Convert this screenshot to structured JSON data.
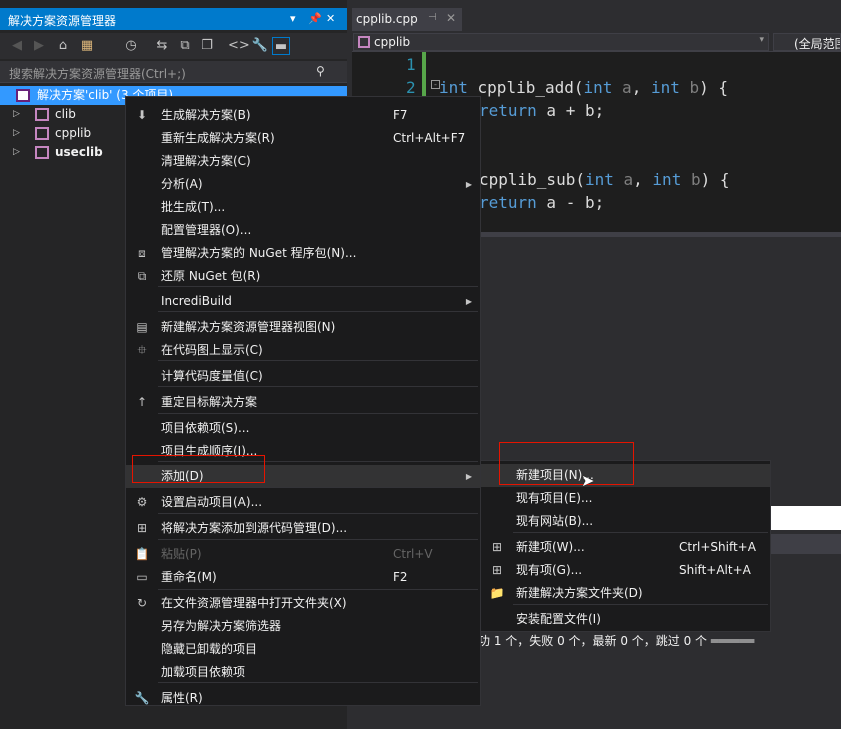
{
  "solution_explorer": {
    "title": "解决方案资源管理器",
    "search_placeholder": "搜索解决方案资源管理器(Ctrl+;)",
    "root_label": "解决方案'clib' (3 个项目)",
    "projects": [
      "clib",
      "cpplib",
      "useclib"
    ]
  },
  "editor": {
    "tab_label": "cpplib.cpp",
    "nav_project": "cpplib",
    "nav_scope": "(全局范围",
    "lines": [
      {
        "num": "1",
        "text": ""
      },
      {
        "num": "2",
        "text": "int cpplib_add(int a, int b) {"
      },
      {
        "num": "",
        "text": "return a + b;"
      },
      {
        "num": "",
        "text": "cpplib_sub(int a, int b) {"
      },
      {
        "num": "",
        "text": "return a - b;"
      }
    ],
    "output_text": "功 1 个，失败 0 个，最新 0 个，跳过 0 个 ══════"
  },
  "context_menu": {
    "items": [
      {
        "label": "生成解决方案(B)",
        "shortcut": "F7",
        "icon": "build-icon"
      },
      {
        "label": "重新生成解决方案(R)",
        "shortcut": "Ctrl+Alt+F7",
        "icon": ""
      },
      {
        "label": "清理解决方案(C)",
        "shortcut": "",
        "icon": ""
      },
      {
        "label": "分析(A)",
        "shortcut": "",
        "icon": ""
      },
      {
        "label": "批生成(T)...",
        "shortcut": "",
        "icon": ""
      },
      {
        "label": "配置管理器(O)...",
        "shortcut": "",
        "icon": ""
      },
      {
        "label": "管理解决方案的 NuGet 程序包(N)...",
        "shortcut": "",
        "icon": "nuget-icon"
      },
      {
        "label": "还原 NuGet 包(R)",
        "shortcut": "",
        "icon": "restore-icon"
      },
      {
        "label": "IncrediBuild",
        "shortcut": "",
        "icon": ""
      },
      {
        "label": "新建解决方案资源管理器视图(N)",
        "shortcut": "",
        "icon": "new-view-icon"
      },
      {
        "label": "在代码图上显示(C)",
        "shortcut": "",
        "icon": "code-map-icon"
      },
      {
        "label": "计算代码度量值(C)",
        "shortcut": "",
        "icon": ""
      },
      {
        "label": "重定目标解决方案",
        "shortcut": "",
        "icon": "retarget-icon"
      },
      {
        "label": "项目依赖项(S)...",
        "shortcut": "",
        "icon": ""
      },
      {
        "label": "项目生成顺序(I)...",
        "shortcut": "",
        "icon": ""
      },
      {
        "label": "添加(D)",
        "shortcut": "",
        "icon": ""
      },
      {
        "label": "设置启动项目(A)...",
        "shortcut": "",
        "icon": "gear-icon"
      },
      {
        "label": "将解决方案添加到源代码管理(D)...",
        "shortcut": "",
        "icon": "source-control-icon"
      },
      {
        "label": "粘贴(P)",
        "shortcut": "Ctrl+V",
        "icon": "paste-icon"
      },
      {
        "label": "重命名(M)",
        "shortcut": "F2",
        "icon": "rename-icon"
      },
      {
        "label": "在文件资源管理器中打开文件夹(X)",
        "shortcut": "",
        "icon": "refresh-icon"
      },
      {
        "label": "另存为解决方案筛选器",
        "shortcut": "",
        "icon": ""
      },
      {
        "label": "隐藏已卸载的项目",
        "shortcut": "",
        "icon": ""
      },
      {
        "label": "加载项目依赖项",
        "shortcut": "",
        "icon": ""
      },
      {
        "label": "属性(R)",
        "shortcut": "",
        "icon": "wrench-icon"
      }
    ]
  },
  "submenu": {
    "items": [
      {
        "label": "新建项目(N)...",
        "shortcut": ""
      },
      {
        "label": "现有项目(E)...",
        "shortcut": ""
      },
      {
        "label": "现有网站(B)...",
        "shortcut": ""
      },
      {
        "label": "新建项(W)...",
        "shortcut": "Ctrl+Shift+A"
      },
      {
        "label": "现有项(G)...",
        "shortcut": "Shift+Alt+A"
      },
      {
        "label": "新建解决方案文件夹(D)",
        "shortcut": ""
      },
      {
        "label": "安装配置文件(I)",
        "shortcut": ""
      }
    ]
  },
  "colors": {
    "accent": "#007acc",
    "highlight_box": "#e51400",
    "selection": "#3399ff"
  }
}
